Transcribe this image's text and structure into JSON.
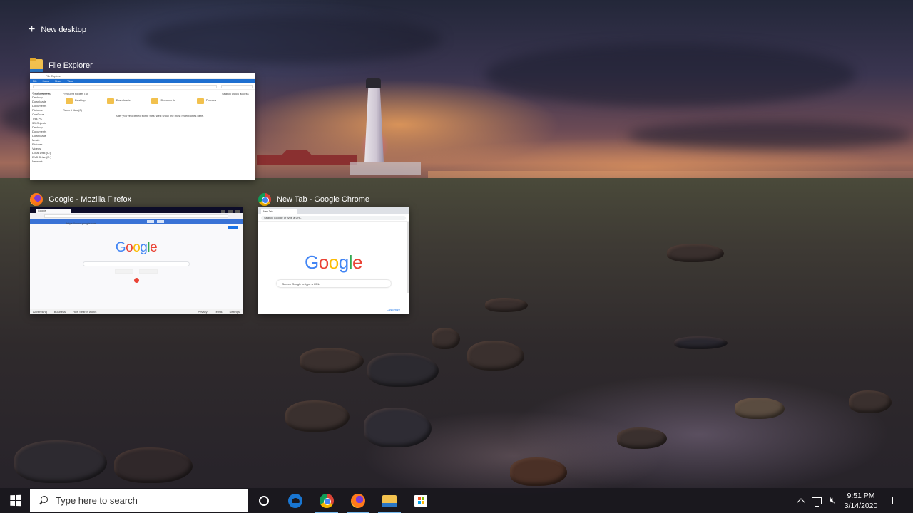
{
  "task_view": {
    "new_desktop_label": "New desktop",
    "windows": [
      {
        "title": "File Explorer",
        "icon": "folder-icon",
        "thumbnail": {
          "window_title": "File Explorer",
          "ribbon_tabs": [
            "File",
            "Home",
            "Share",
            "View"
          ],
          "address": "Quick access",
          "search_placeholder": "Search Quick access",
          "frequent_folders_header": "Frequent folders (4)",
          "folders": [
            "Desktop",
            "Downloads",
            "Documents",
            "Pictures"
          ],
          "recent_files_header": "Recent files (0)",
          "empty_message": "After you've opened some files, we'll show the most recent ones here.",
          "nav_items": [
            "Quick access",
            "Desktop",
            "Downloads",
            "Documents",
            "Pictures",
            "OneDrive",
            "This PC",
            "3D Objects",
            "Desktop",
            "Documents",
            "Downloads",
            "Music",
            "Pictures",
            "Videos",
            "Local Disk (C:)",
            "DVD Drive (D:)",
            "Network"
          ]
        }
      },
      {
        "title": "Google - Mozilla Firefox",
        "icon": "firefox-icon",
        "thumbnail": {
          "tab_label": "Google",
          "url": "https://www.google.com",
          "logo": [
            "G",
            "o",
            "o",
            "g",
            "l",
            "e"
          ],
          "footer_links": [
            "Advertising",
            "Business",
            "How Search works",
            "Privacy",
            "Terms",
            "Settings"
          ]
        }
      },
      {
        "title": "New Tab - Google Chrome",
        "icon": "chrome-icon",
        "thumbnail": {
          "tab_label": "New Tab",
          "omnibox_placeholder": "Search Google or type a URL",
          "logo": [
            "G",
            "o",
            "o",
            "g",
            "l",
            "e"
          ],
          "search_placeholder": "Search Google or type a URL",
          "customize_label": "Customize"
        }
      }
    ]
  },
  "taskbar": {
    "search_placeholder": "Type here to search",
    "pinned": [
      "cortana-icon",
      "edge-icon",
      "chrome-icon",
      "firefox-icon",
      "file-explorer-icon",
      "store-icon"
    ],
    "tray": {
      "time": "9:51 PM",
      "date": "3/14/2020"
    }
  },
  "colors": {
    "taskbar_bg": "#1a181e",
    "active_indicator": "#76b9ed",
    "google_blue": "#4285f4",
    "google_red": "#ea4335",
    "google_yellow": "#fbbc05",
    "google_green": "#34a853"
  }
}
